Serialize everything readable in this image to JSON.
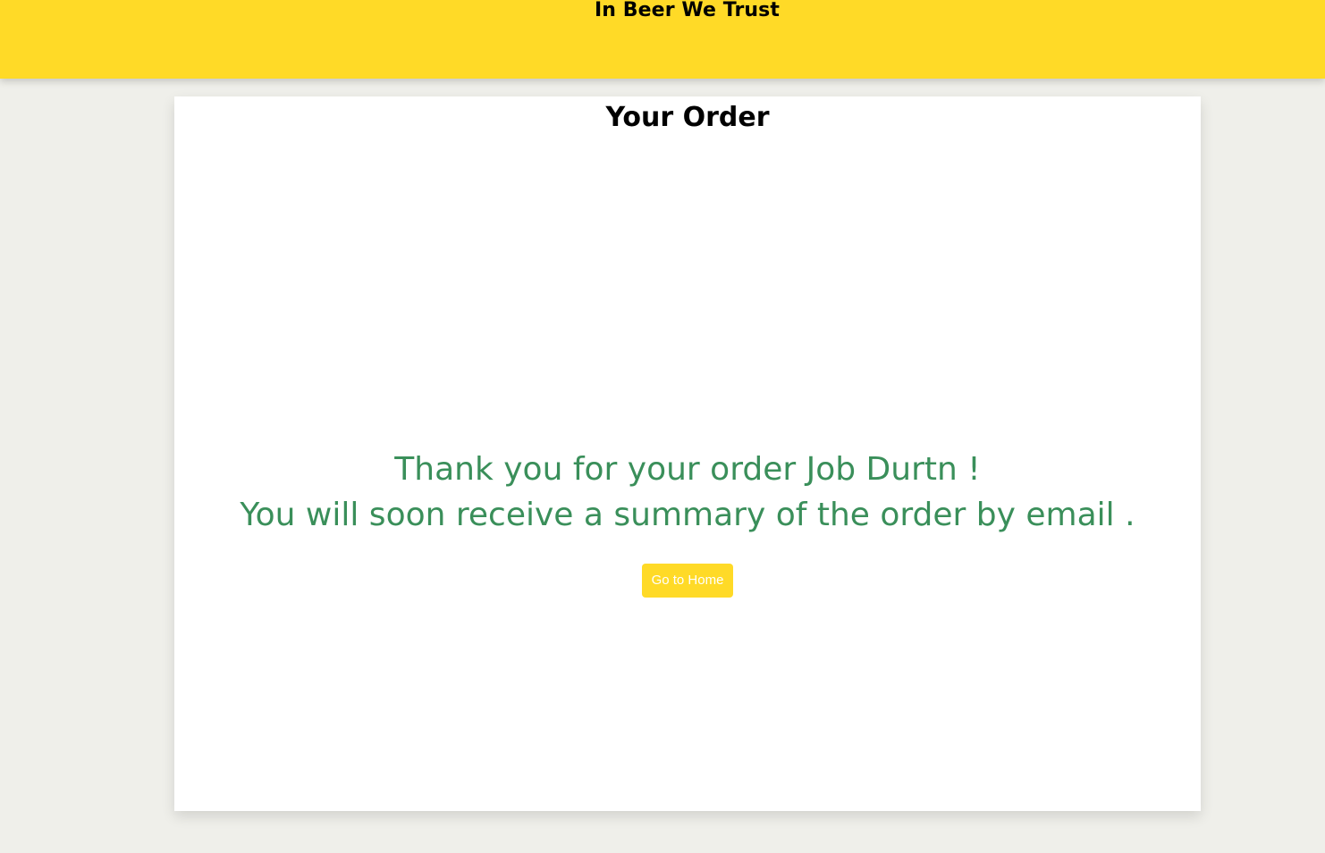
{
  "header": {
    "brand": "In Beer We Trust",
    "background_color": "#ffda27"
  },
  "main": {
    "title": "Your Order",
    "message_line_1": "Thank you for your order Job Durtn !",
    "message_line_2": "You will soon receive a summary of the order by email .",
    "message_color": "#3a8f5a",
    "home_button_label": "Go to Home"
  },
  "page": {
    "background_color": "#efefea",
    "card_color": "#ffffff"
  }
}
